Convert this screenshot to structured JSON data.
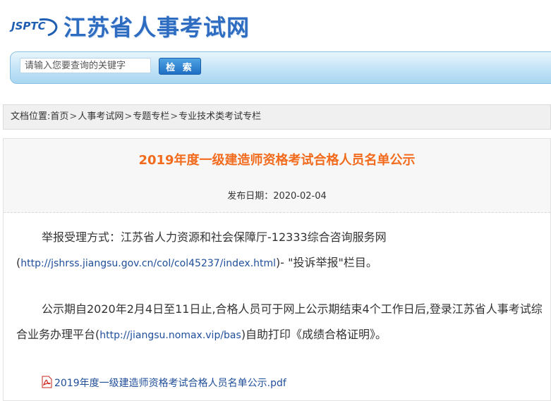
{
  "header": {
    "logo_abbr": "JSPTC",
    "site_name": "江苏省人事考试网"
  },
  "search": {
    "placeholder": "请输入您要查询的关键字",
    "button_label": "检 索"
  },
  "breadcrumb": {
    "prefix": "文档位置:",
    "items": [
      "首页",
      "人事考试网",
      "专题专栏",
      "专业技术类考试专栏"
    ],
    "separator": ">"
  },
  "article": {
    "title": "2019年度一级建造师资格考试合格人员名单公示",
    "date_label": "发布日期：",
    "date": "2020-02-04",
    "p1_text1": "举报受理方式：江苏省人力资源和社会保障厅-12333综合咨询服务网",
    "p1_open": "(",
    "p1_link": "http://jshrss.jiangsu.gov.cn/col/col45237/index.html",
    "p1_text2": ")- \"投诉举报\"栏目。",
    "p2_text1": "公示期自2020年2月4日至11日止,合格人员可于网上公示期结束4个工作日后,登录江苏省人事考试综合业务办理平台(",
    "p2_link": "http://jiangsu.nomax.vip/bas",
    "p2_text2": ")自助打印《成绩合格证明》。",
    "attachment": "2019年度一级建造师资格考试合格人员名单公示.pdf"
  },
  "colors": {
    "brand": "#2d6cc0",
    "title_accent": "#f26b1d",
    "link": "#1f4e9a"
  },
  "icons": [
    "pdf-icon"
  ]
}
